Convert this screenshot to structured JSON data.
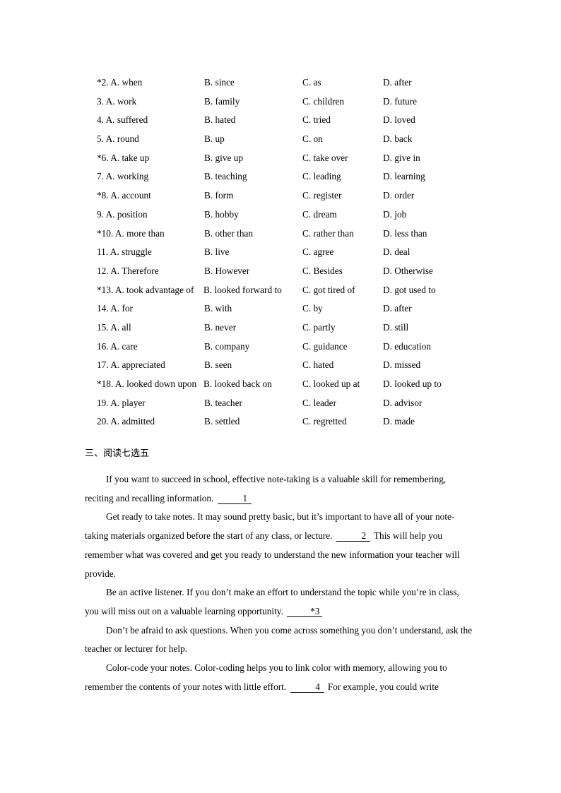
{
  "cloze": {
    "rows": [
      {
        "a": "*2. A. when",
        "b": "B. since",
        "c": "C. as",
        "d": "D. after"
      },
      {
        "a": "3. A. work",
        "b": "B. family",
        "c": "C. children",
        "d": "D. future"
      },
      {
        "a": "4. A. suffered",
        "b": "B. hated",
        "c": "C. tried",
        "d": "D. loved"
      },
      {
        "a": "5. A. round",
        "b": "B. up",
        "c": "C. on",
        "d": "D. back"
      },
      {
        "a": "*6. A. take up",
        "b": "B. give up",
        "c": "C. take over",
        "d": "D. give in"
      },
      {
        "a": "7. A. working",
        "b": "B. teaching",
        "c": "C. leading",
        "d": "D. learning"
      },
      {
        "a": "*8. A. account",
        "b": "B. form",
        "c": "C. register",
        "d": "D. order"
      },
      {
        "a": "9. A. position",
        "b": "B. hobby",
        "c": "C. dream",
        "d": "D. job"
      },
      {
        "a": "*10. A. more than",
        "b": "B. other than",
        "c": "C. rather than",
        "d": "D. less than"
      },
      {
        "a": "11. A. struggle",
        "b": "B. live",
        "c": "C. agree",
        "d": "D. deal"
      },
      {
        "a": "12. A. Therefore",
        "b": "B. However",
        "c": "C. Besides",
        "d": "D. Otherwise"
      },
      {
        "a": "*13. A. took advantage of",
        "b": "B. looked forward to",
        "c": "C. got tired of",
        "d": "D. got used to"
      },
      {
        "a": "14. A. for",
        "b": "B. with",
        "c": "C. by",
        "d": "D. after"
      },
      {
        "a": "15. A. all",
        "b": "B. never",
        "c": "C. partly",
        "d": "D. still"
      },
      {
        "a": "16. A. care",
        "b": "B. company",
        "c": "C. guidance",
        "d": "D. education"
      },
      {
        "a": "17. A. appreciated",
        "b": "B. seen",
        "c": "C. hated",
        "d": "D. missed"
      },
      {
        "a": "*18. A. looked down upon",
        "b": "B. looked back on",
        "c": "C. looked up at",
        "d": "D. looked up to"
      },
      {
        "a": "19. A. player",
        "b": "B. teacher",
        "c": "C. leader",
        "d": "D. advisor"
      },
      {
        "a": "20. A. admitted",
        "b": "B. settled",
        "c": "C. regretted",
        "d": "D. made"
      }
    ]
  },
  "reading": {
    "heading": "三、阅读七选五",
    "paragraphs": [
      {
        "text_before": "If you want to succeed in school, effective note-taking is a valuable skill for remembering, reciting and recalling information.",
        "blank": "1",
        "text_after": ""
      },
      {
        "text_before": "Get ready to take notes. It may sound pretty basic, but it’s important to have all of your note-taking materials organized before the start of any class, or lecture.",
        "blank": "2",
        "text_after": "This will help you remember what was covered and get you ready to understand the new information your teacher will provide."
      },
      {
        "text_before": "Be an active listener. If you don’t make an effort to understand the topic while you’re in class, you will miss out on a valuable learning opportunity.",
        "blank": "*3",
        "text_after": ""
      },
      {
        "text_before": "Don’t be afraid to ask questions. When you come across something you don’t understand, ask the teacher or lecturer for help.",
        "blank": "",
        "text_after": ""
      },
      {
        "text_before": "Color-code your notes. Color-coding helps you to link color with memory, allowing you to remember the contents of your notes with little effort.",
        "blank": "4",
        "text_after": "For example, you could write"
      }
    ]
  },
  "colors": {
    "page_background": "#ffffff",
    "text": "#000000"
  }
}
